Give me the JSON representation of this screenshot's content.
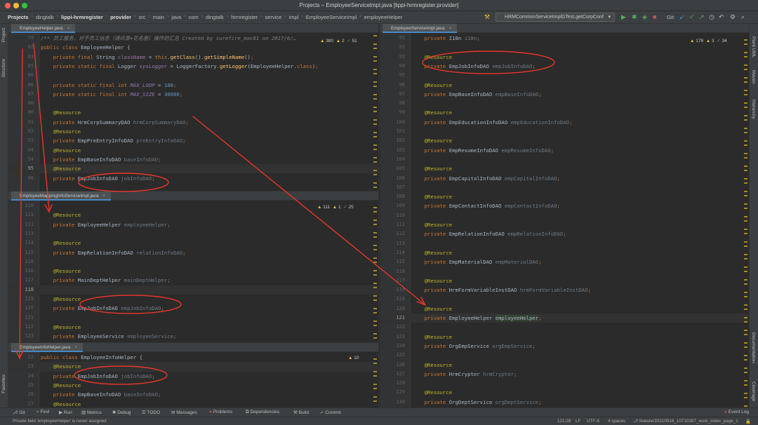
{
  "window": {
    "title": "Projects – EmployeeServiceImpl.java [lippi-hrmregister.provider]"
  },
  "navbar": {
    "crumbs": [
      {
        "label": "Projects",
        "bold": true
      },
      {
        "label": "dingtalk"
      },
      {
        "label": "lippi-hrmregister",
        "bold": true
      },
      {
        "label": "provider",
        "bold": true
      },
      {
        "label": "src"
      },
      {
        "label": "main"
      },
      {
        "label": "java"
      },
      {
        "label": "com"
      },
      {
        "label": "dingtalk"
      },
      {
        "label": "hrmregister"
      },
      {
        "label": "service"
      },
      {
        "label": "impl"
      },
      {
        "label": "EmployeeServiceImpl"
      },
      {
        "label": "employeeHelper"
      }
    ],
    "run_config": "HRMCommonServiceImplGTest.getCorpConf",
    "git_label": "Git:"
  },
  "left_strip": [
    "Project",
    "Structure",
    "Favorites"
  ],
  "right_strip": [
    "Plant UML",
    "Maven",
    "Hierarchy",
    "Documentation",
    "Coverage"
  ],
  "panes": {
    "helper": {
      "tab": "EmployeeHelper.java",
      "inspections": {
        "warnings": "380",
        "weak": "2",
        "ok": "51"
      },
      "lines": [
        {
          "n": "79",
          "t": "/** 员工服务，对于员工信息（通讯录+花名册）操作的汇总 Created by surefire_mac01 on 2017/6/…",
          "kind": "comment"
        },
        {
          "n": "82",
          "t": "public class EmployeeHelper {",
          "kind": "classdecl"
        },
        {
          "n": "83",
          "t": "    private final String className = this.getClass().getSimpleName();",
          "kind": "field"
        },
        {
          "n": "85",
          "t": "    private static final Logger sysLogger = LoggerFactory.getLogger(EmployeeHelper.class);",
          "kind": "field"
        },
        {
          "n": "86",
          "t": "",
          "kind": "blank"
        },
        {
          "n": "86",
          "t": "    private static final int MAX_LOOP = 100;",
          "kind": "const"
        },
        {
          "n": "87",
          "t": "    private static final int MAX_SIZE = 30000;",
          "kind": "const"
        },
        {
          "n": "88",
          "t": "",
          "kind": "blank"
        },
        {
          "n": "90",
          "t": "    @Resource",
          "kind": "ann"
        },
        {
          "n": "91",
          "t": "    private HrmCorpSummaryDAO hrmCorpSummaryDAO;",
          "kind": "res"
        },
        {
          "n": "92",
          "t": "    @Resource",
          "kind": "ann"
        },
        {
          "n": "93",
          "t": "    private EmpPreEntryInfoDAO preEntryInfoDAO;",
          "kind": "res"
        },
        {
          "n": "94",
          "t": "    @Resource",
          "kind": "ann"
        },
        {
          "n": "94",
          "t": "    private EmpBaseInfoDAO baseInfoDAO;",
          "kind": "res"
        },
        {
          "n": "95",
          "t": "    @Resource",
          "kind": "ann",
          "hl": true,
          "cur": true
        },
        {
          "n": "96",
          "t": "    private EmpJobInfoDAO jobInfoDAO;",
          "kind": "res"
        }
      ]
    },
    "mapping": {
      "tab": "EmployeeMappingInfoServiceImpl.java",
      "inspections": {
        "warnings": "111",
        "weak": "1",
        "ok": "25"
      },
      "lines": [
        {
          "n": "110",
          "t": "",
          "kind": "blank"
        },
        {
          "n": "111",
          "t": "    @Resource",
          "kind": "ann"
        },
        {
          "n": "111",
          "t": "    private EmployeeHelper employeeHelper;",
          "kind": "res"
        },
        {
          "n": "113",
          "t": "",
          "kind": "blank"
        },
        {
          "n": "114",
          "t": "    @Resource",
          "kind": "ann"
        },
        {
          "n": "115",
          "t": "    private EmpRelationInfoDAO relationInfoDAO;",
          "kind": "res"
        },
        {
          "n": "116",
          "t": "",
          "kind": "blank"
        },
        {
          "n": "116",
          "t": "    @Resource",
          "kind": "ann"
        },
        {
          "n": "117",
          "t": "    private MainDeptHelper mainDeptHelper;",
          "kind": "res"
        },
        {
          "n": "118",
          "t": "",
          "kind": "blank",
          "hl": true,
          "cur": true
        },
        {
          "n": "119",
          "t": "    @Resource",
          "kind": "ann"
        },
        {
          "n": "120",
          "t": "    private EmpJobInfoDAO empJobInfoDAO;",
          "kind": "res"
        },
        {
          "n": "121",
          "t": "",
          "kind": "blank"
        },
        {
          "n": "122",
          "t": "    @Resource",
          "kind": "ann"
        },
        {
          "n": "123",
          "t": "    private EmployeeService employeeService;",
          "kind": "res"
        }
      ]
    },
    "info": {
      "tab": "EmployeeInfoHelper.java",
      "inspections": {
        "warnings": "10"
      },
      "lines": [
        {
          "n": "22",
          "t": "public class EmployeeInfoHelper {",
          "kind": "classdecl"
        },
        {
          "n": "23",
          "t": "    @Resource",
          "kind": "ann",
          "hl": true
        },
        {
          "n": "24",
          "t": "    private EmpJobInfoDAO jobInfoDAO;",
          "kind": "res"
        },
        {
          "n": "25",
          "t": "    @Resource",
          "kind": "ann"
        },
        {
          "n": "26",
          "t": "    private EmpBaseInfoDAO baseInfoDAO;",
          "kind": "res"
        },
        {
          "n": "27",
          "t": "    @Resource",
          "kind": "ann"
        }
      ]
    },
    "service": {
      "tab": "EmployeeServiceImpl.java",
      "inspections": {
        "warnings": "178",
        "weak": "3",
        "ok": "34"
      },
      "lines": [
        {
          "n": "91",
          "t": "    private I18n i18n;",
          "kind": "res"
        },
        {
          "n": "92",
          "t": "",
          "kind": "blank"
        },
        {
          "n": "93",
          "t": "    @Resource",
          "kind": "ann"
        },
        {
          "n": "94",
          "t": "    private EmpJobInfoDAO empJobInfoDAO;",
          "kind": "res"
        },
        {
          "n": "95",
          "t": "",
          "kind": "blank"
        },
        {
          "n": "96",
          "t": "    @Resource",
          "kind": "ann"
        },
        {
          "n": "97",
          "t": "    private EmpBaseInfoDAO empBaseInfoDAO;",
          "kind": "res"
        },
        {
          "n": "98",
          "t": "",
          "kind": "blank"
        },
        {
          "n": "99",
          "t": "    @Resource",
          "kind": "ann"
        },
        {
          "n": "100",
          "t": "    private EmpEducationInfoDAO empEducationInfoDAO;",
          "kind": "res"
        },
        {
          "n": "101",
          "t": "",
          "kind": "blank"
        },
        {
          "n": "102",
          "t": "    @Resource",
          "kind": "ann"
        },
        {
          "n": "103",
          "t": "    private EmpResumeInfoDAO empResumeInfoDAO;",
          "kind": "res"
        },
        {
          "n": "104",
          "t": "",
          "kind": "blank"
        },
        {
          "n": "105",
          "t": "    @Resource",
          "kind": "ann"
        },
        {
          "n": "106",
          "t": "    private EmpCapitalInfoDAO empCapitalInfoDAO;",
          "kind": "res"
        },
        {
          "n": "107",
          "t": "",
          "kind": "blank"
        },
        {
          "n": "108",
          "t": "    @Resource",
          "kind": "ann"
        },
        {
          "n": "109",
          "t": "    private EmpContactInfoDAO empContactInfoDAO;",
          "kind": "res"
        },
        {
          "n": "110",
          "t": "",
          "kind": "blank"
        },
        {
          "n": "111",
          "t": "    @Resource",
          "kind": "ann"
        },
        {
          "n": "112",
          "t": "    private EmpRelationInfoDAO empRelationInfoDAO;",
          "kind": "res"
        },
        {
          "n": "113",
          "t": "",
          "kind": "blank"
        },
        {
          "n": "114",
          "t": "    @Resource",
          "kind": "ann"
        },
        {
          "n": "115",
          "t": "    private EmpMaterialDAO empMaterialDAO;",
          "kind": "res"
        },
        {
          "n": "116",
          "t": "",
          "kind": "blank"
        },
        {
          "n": "117",
          "t": "    @Resource",
          "kind": "ann"
        },
        {
          "n": "118",
          "t": "    private HrmFormVariableInstDAO hrmFormVariableInstDAO;",
          "kind": "res"
        },
        {
          "n": "119",
          "t": "",
          "kind": "blank"
        },
        {
          "n": "120",
          "t": "    @Resource",
          "kind": "ann"
        },
        {
          "n": "121",
          "t": "    private EmployeeHelper employeeHelper;",
          "kind": "res",
          "hl": true,
          "cur": true,
          "hlword": "employeeHelper"
        },
        {
          "n": "122",
          "t": "",
          "kind": "blank"
        },
        {
          "n": "123",
          "t": "    @Resource",
          "kind": "ann"
        },
        {
          "n": "124",
          "t": "    private OrgEmpService orgEmpService;",
          "kind": "res"
        },
        {
          "n": "125",
          "t": "",
          "kind": "blank"
        },
        {
          "n": "126",
          "t": "    @Resource",
          "kind": "ann"
        },
        {
          "n": "127",
          "t": "    private HrmCrypter hrmCrypter;",
          "kind": "res"
        },
        {
          "n": "128",
          "t": "",
          "kind": "blank"
        },
        {
          "n": "129",
          "t": "    @Resource",
          "kind": "ann"
        },
        {
          "n": "130",
          "t": "    private OrgDeptService orgDeptService;",
          "kind": "res"
        }
      ]
    }
  },
  "toolbar": [
    "Git",
    "Find",
    "Run",
    "Metrics",
    "Debug",
    "TODO",
    "Messages",
    "Problems",
    "Dependencies",
    "Build",
    "Commit"
  ],
  "event_log": "Event Log",
  "status": {
    "message": "Private field 'employeeHelper' is never assigned",
    "position": "121:28",
    "line_sep": "LF",
    "encoding": "UTF-8",
    "indent": "4 spaces",
    "branch": "feature/20210916_10710397_work_index_page_1"
  },
  "colors": {
    "accent": "#4a88c7",
    "annotation": "#bbb529",
    "keyword": "#cc7832",
    "markup_red": "#e8362b"
  }
}
